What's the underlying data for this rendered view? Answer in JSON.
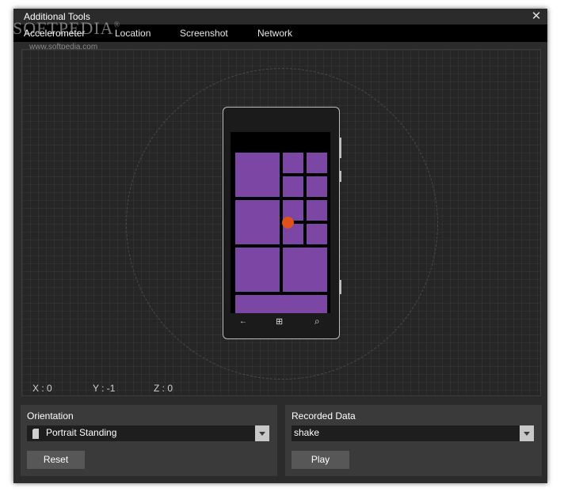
{
  "window": {
    "title": "Additional Tools",
    "close_glyph": "✕"
  },
  "watermark": {
    "brand": "SOFTPEDIA",
    "mark": "®",
    "url": "www.softpedia.com"
  },
  "tabs": [
    {
      "label": "Accelerometer",
      "active": true
    },
    {
      "label": "Location",
      "active": false
    },
    {
      "label": "Screenshot",
      "active": false
    },
    {
      "label": "Network",
      "active": false
    }
  ],
  "phone": {
    "tile_color": "#7b46a4",
    "indicator_color": "#e0521c",
    "nav_icons": [
      "back-arrow-icon",
      "windows-logo-icon",
      "search-icon"
    ],
    "nav_glyphs": {
      "back": "←",
      "start": "⊞",
      "search": "⌕"
    }
  },
  "coords": {
    "x": "X : 0",
    "y": "Y : -1",
    "z": "Z : 0"
  },
  "orientation": {
    "label": "Orientation",
    "selected": "Portrait Standing",
    "button": "Reset"
  },
  "recorded": {
    "label": "Recorded Data",
    "selected": "shake",
    "button": "Play"
  }
}
